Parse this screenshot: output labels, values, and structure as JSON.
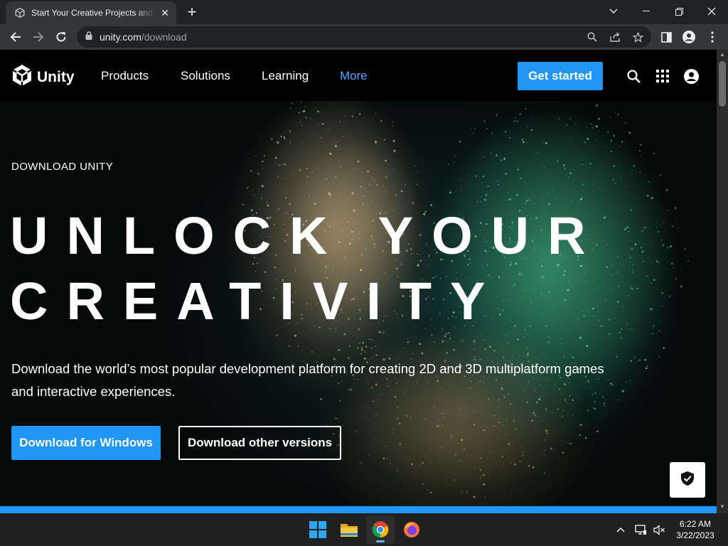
{
  "browser": {
    "tab_title": "Start Your Creative Projects and Download",
    "tab_close": "✕",
    "new_tab": "+",
    "url_host": "unity.com",
    "url_path": "/download"
  },
  "site": {
    "logo_text": "Unity",
    "nav": [
      "Products",
      "Solutions",
      "Learning",
      "More"
    ],
    "get_started": "Get started"
  },
  "hero": {
    "eyebrow": "DOWNLOAD UNITY",
    "headline_line1": "UNLOCK YOUR",
    "headline_line2": "CREATIVITY",
    "subtext": "Download the world’s most popular development platform for creating 2D and 3D multiplatform games and interactive experiences.",
    "primary_button": "Download for Windows",
    "secondary_button": "Download other versions"
  },
  "colors": {
    "accent": "#2196f3",
    "active_nav": "#4da6ff"
  },
  "taskbar": {
    "time": "6:22 AM",
    "date": "3/22/2023"
  }
}
